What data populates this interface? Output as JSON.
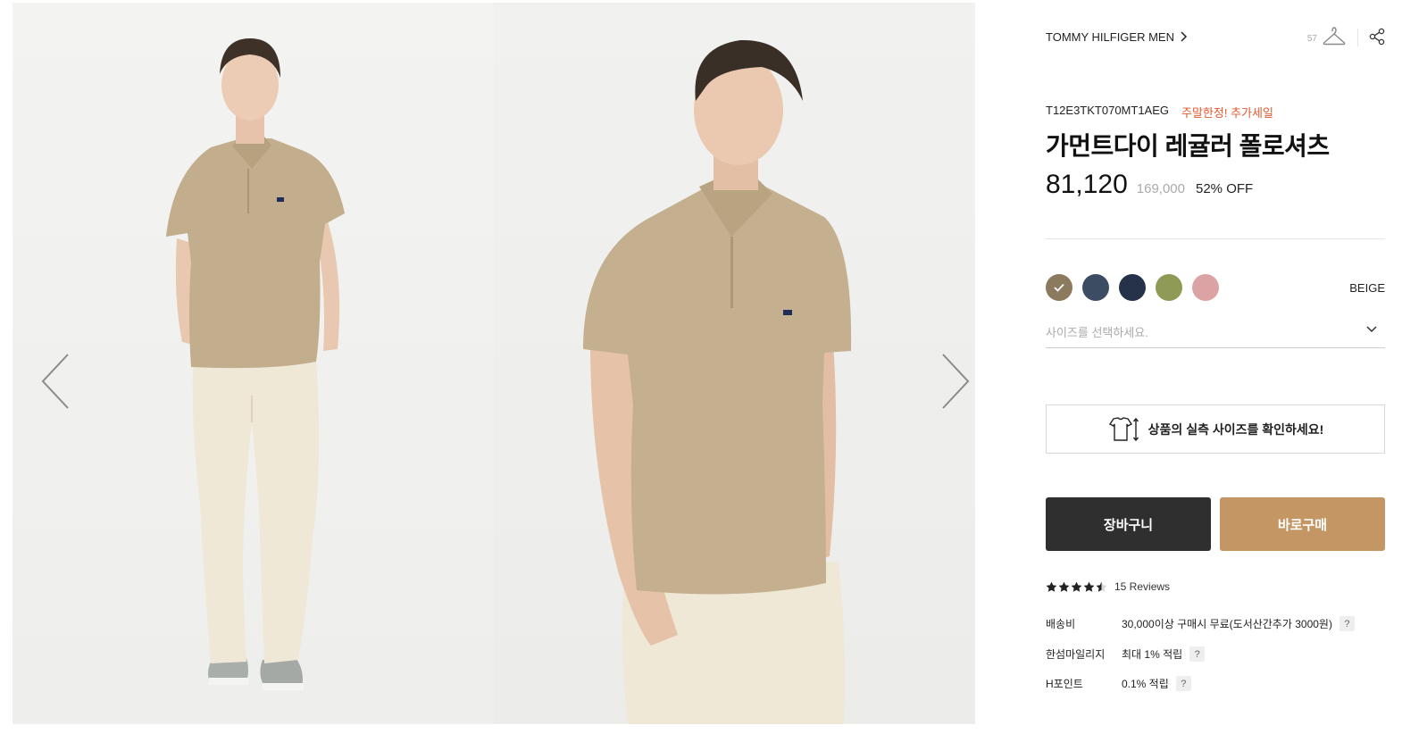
{
  "product": {
    "brand": "TOMMY HILFIGER MEN",
    "like_count": "57",
    "code": "T12E3TKT070MT1AEG",
    "promo": "주말한정! 추가세일",
    "title": "가먼트다이 레귤러 폴로셔츠",
    "price": "81,120",
    "original_price": "169,000",
    "discount": "52% OFF"
  },
  "colors": {
    "selected_name": "BEIGE",
    "swatches": [
      {
        "name": "beige",
        "hex": "#8b7a5e",
        "selected": true
      },
      {
        "name": "blue-grey",
        "hex": "#3c4c62"
      },
      {
        "name": "navy",
        "hex": "#26324a"
      },
      {
        "name": "olive",
        "hex": "#8e9a55"
      },
      {
        "name": "pink",
        "hex": "#dba3a3"
      }
    ]
  },
  "size": {
    "placeholder": "사이즈를 선택하세요."
  },
  "size_guide": {
    "label": "상품의 실측 사이즈를 확인하세요!"
  },
  "buttons": {
    "cart": "장바구니",
    "buy": "바로구매"
  },
  "reviews": {
    "rating": 4.5,
    "label": "15 Reviews"
  },
  "meta": [
    {
      "label": "배송비",
      "value": "30,000이상 구매시 무료(도서산간추가 3000원)"
    },
    {
      "label": "한섬마일리지",
      "value": "최대 1% 적립"
    },
    {
      "label": "H포인트",
      "value": "0.1% 적립"
    }
  ],
  "help_glyph": "?",
  "theme": {
    "accent_buy": "#c49664",
    "cart_dark": "#2f2f2f",
    "promo_red": "#e4572e",
    "shirt_khaki": "#c2ad8c",
    "pants_cream": "#efe8d6"
  },
  "icons": {
    "prev": "chevron-left-icon",
    "next": "chevron-right-icon",
    "like": "hanger-icon",
    "share": "share-icon",
    "size_guide": "tshirt-measure-icon"
  }
}
